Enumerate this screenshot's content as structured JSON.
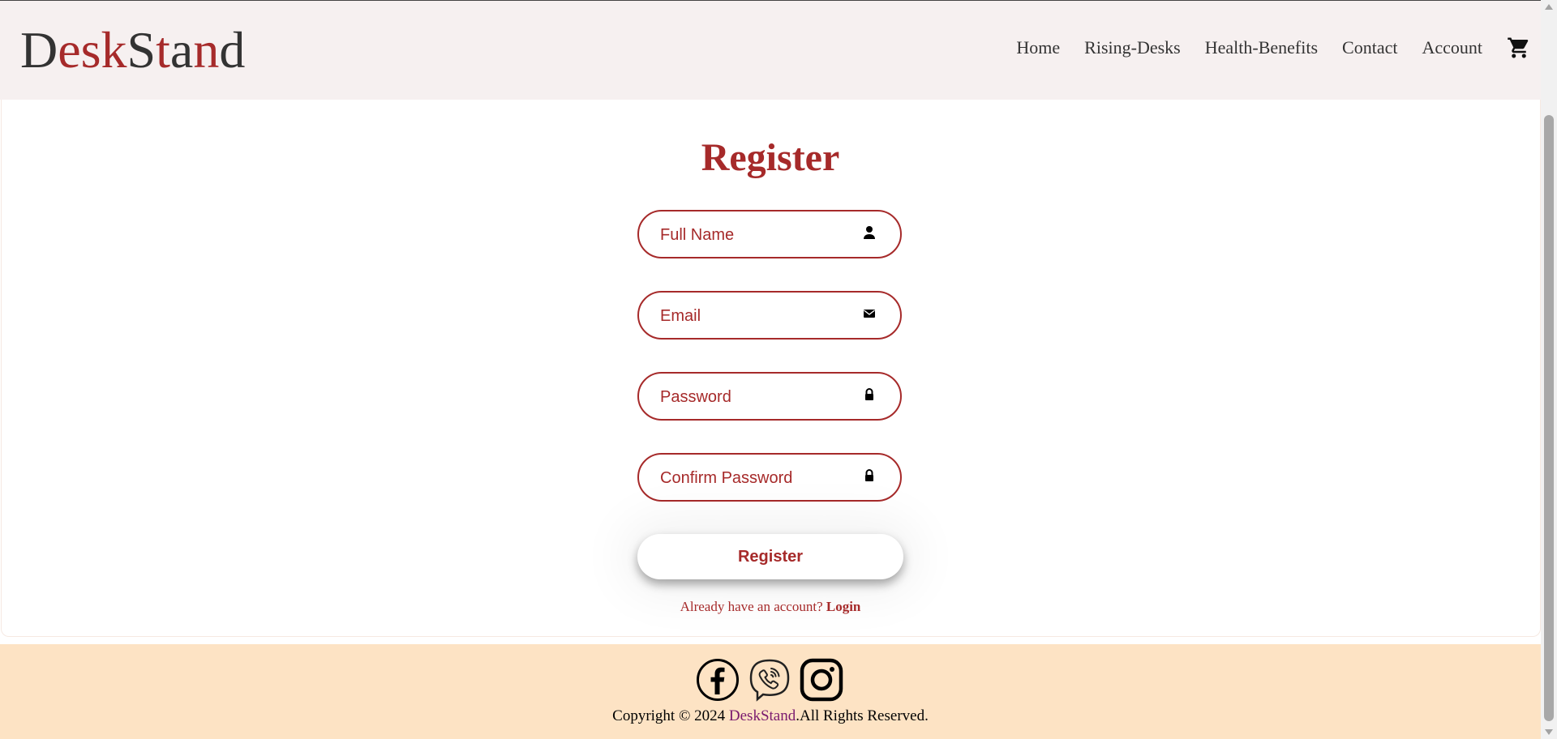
{
  "brand": {
    "name": "DeskStand"
  },
  "nav": {
    "items": [
      {
        "label": "Home"
      },
      {
        "label": "Rising-Desks"
      },
      {
        "label": "Health-Benefits"
      },
      {
        "label": "Contact"
      },
      {
        "label": "Account"
      }
    ],
    "cart_icon": "shopping-cart-icon"
  },
  "form": {
    "title": "Register",
    "fields": [
      {
        "placeholder": "Full Name",
        "icon": "user-icon"
      },
      {
        "placeholder": "Email",
        "icon": "envelope-icon"
      },
      {
        "placeholder": "Password",
        "icon": "lock-icon"
      },
      {
        "placeholder": "Confirm Password",
        "icon": "lock-icon"
      }
    ],
    "submit_label": "Register",
    "login_prompt": "Already have an account?",
    "login_link": "Login"
  },
  "footer": {
    "social": [
      "facebook-icon",
      "viber-icon",
      "instagram-icon"
    ],
    "copyright_prefix": "Copyright © 2024 ",
    "copyright_brand": "DeskStand",
    "copyright_suffix": ".All Rights Reserved."
  },
  "colors": {
    "accent": "#a62a2a",
    "header_bg": "#f6f0f0",
    "footer_bg": "#fde3c4",
    "brand_link": "#7a1a6e"
  }
}
